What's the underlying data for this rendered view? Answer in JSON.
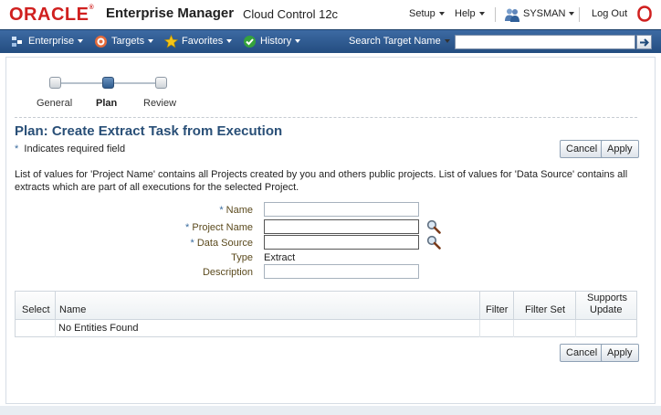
{
  "header": {
    "logo": "ORACLE",
    "logo_mark": "®",
    "product": "Enterprise Manager",
    "edition": "Cloud Control 12c",
    "setup_label": "Setup",
    "help_label": "Help",
    "user_label": "SYSMAN",
    "logout_label": "Log Out"
  },
  "nav": {
    "enterprise": "Enterprise",
    "targets": "Targets",
    "favorites": "Favorites",
    "history": "History",
    "search_label": "Search Target Name",
    "search_value": ""
  },
  "train": {
    "steps": [
      "General",
      "Plan",
      "Review"
    ],
    "active": 1
  },
  "page": {
    "title": "Plan: Create Extract Task from Execution",
    "required_star": "*",
    "required_note": "Indicates required field",
    "cancel_label": "Cancel",
    "apply_label": "Apply",
    "info": "List of values for 'Project Name' contains all Projects created by you and others public projects. List of values for 'Data Source' contains all extracts which are part of all executions for the selected Project."
  },
  "form": {
    "name_label": "Name",
    "name_value": "",
    "project_label": "Project Name",
    "project_value": "",
    "source_label": "Data Source",
    "source_value": "",
    "type_label": "Type",
    "type_value": "Extract",
    "description_label": "Description",
    "description_value": ""
  },
  "table": {
    "columns": [
      "Select",
      "Name",
      "Filter",
      "Filter Set",
      "Supports Update"
    ],
    "col1": "Select",
    "col2": "Name",
    "col3": "Filter",
    "col4": "Filter Set",
    "col5_line1": "Supports",
    "col5_line2": "Update",
    "empty_message": "No Entities Found"
  },
  "colors": {
    "brand_red": "#d0201f",
    "nav_blue": "#2c5689",
    "title_blue": "#294f77"
  }
}
